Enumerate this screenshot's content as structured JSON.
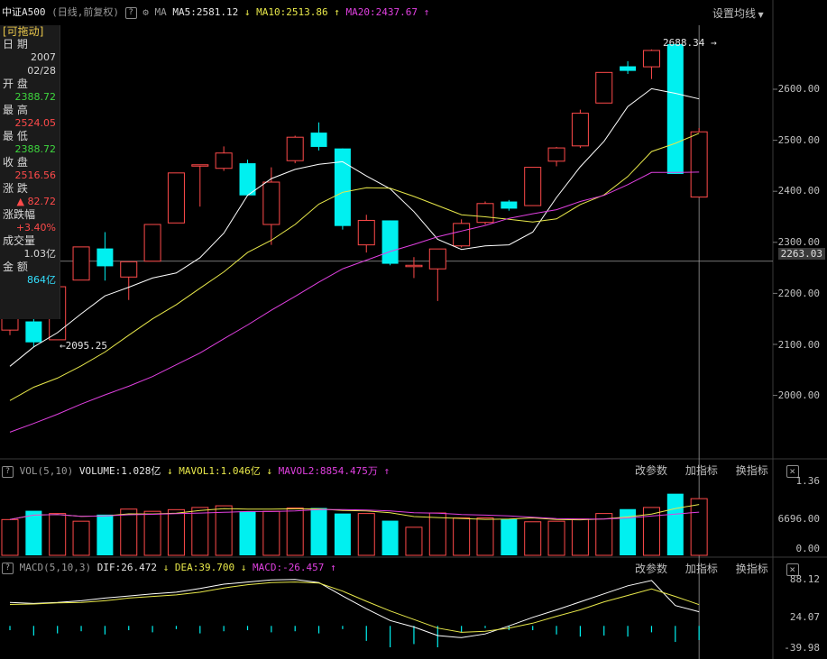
{
  "header": {
    "symbol": "中证A500",
    "period": "(日线,前复权)",
    "help_label": "?",
    "ma_label": "MA",
    "ma5": "MA5:2581.12",
    "ma10": "MA10:2513.86",
    "ma20": "MA20:2437.67",
    "settings_label": "设置均线",
    "arrow_down": "↓",
    "arrow_up": "↑"
  },
  "info": {
    "drag_label": "[可拖动]",
    "date_label": "日  期",
    "date_year": "2007",
    "date_md": "02/28",
    "open_label": "开  盘",
    "open": "2388.72",
    "high_label": "最  高",
    "high": "2524.05",
    "low_label": "最  低",
    "low": "2388.72",
    "close_label": "收  盘",
    "close": "2516.56",
    "change_label": "涨  跌",
    "change": "▲ 82.72",
    "pct_label": "涨跌幅",
    "pct": "+3.40%",
    "volume_label": "成交量",
    "volume": "1.03亿",
    "amount_label": "金  额",
    "amount": "864亿"
  },
  "annotations": {
    "max_label": "2688.34 →",
    "min_label": "←2095.25",
    "cursor_price": "2263.03"
  },
  "price_axis": [
    "2600.00",
    "2500.00",
    "2400.00",
    "2300.00",
    "2200.00",
    "2100.00",
    "2000.00"
  ],
  "volume_panel": {
    "title": "VOL(5,10)",
    "volume": "VOLUME:1.028亿",
    "mavol1": "MAVOL1:1.046亿",
    "mavol2": "MAVOL2:8854.475万",
    "axis": [
      "1.36",
      "6696.00",
      "0.00"
    ]
  },
  "macd_panel": {
    "title": "MACD(5,10,3)",
    "dif": "DIF:26.472",
    "dea": "DEA:39.700",
    "macd": "MACD:-26.457",
    "axis": [
      "88.12",
      "24.07",
      "-39.98"
    ]
  },
  "buttons": {
    "change_params": "改参数",
    "add_indicator": "加指标",
    "switch_indicator": "换指标",
    "close": "×"
  },
  "colors": {
    "up": "#ff4a4a",
    "down": "#00f0f0",
    "ma5": "#ffffff",
    "ma10": "#e8e84a",
    "ma20": "#e040e0"
  },
  "chart_data": {
    "type": "candlestick",
    "price_range": [
      1900,
      2730
    ],
    "candles": [
      {
        "o": 2128,
        "c": 2165,
        "h": 2175,
        "l": 2118
      },
      {
        "o": 2145,
        "c": 2104,
        "h": 2150,
        "l": 2095.25
      },
      {
        "o": 2109,
        "c": 2213,
        "h": 2213,
        "l": 2109
      },
      {
        "o": 2226,
        "c": 2291,
        "h": 2291,
        "l": 2226
      },
      {
        "o": 2288,
        "c": 2253,
        "h": 2320,
        "l": 2225
      },
      {
        "o": 2232,
        "c": 2262,
        "h": 2262,
        "l": 2187
      },
      {
        "o": 2263,
        "c": 2335,
        "h": 2335,
        "l": 2263
      },
      {
        "o": 2338,
        "c": 2436,
        "h": 2436,
        "l": 2338
      },
      {
        "o": 2452,
        "c": 2452,
        "h": 2452,
        "l": 2370
      },
      {
        "o": 2445,
        "c": 2475,
        "h": 2488,
        "l": 2440
      },
      {
        "o": 2455,
        "c": 2392,
        "h": 2462,
        "l": 2392
      },
      {
        "o": 2335,
        "c": 2418,
        "h": 2447,
        "l": 2295
      },
      {
        "o": 2460,
        "c": 2506,
        "h": 2509,
        "l": 2455
      },
      {
        "o": 2515,
        "c": 2487,
        "h": 2535,
        "l": 2480
      },
      {
        "o": 2484,
        "c": 2332,
        "h": 2484,
        "l": 2325
      },
      {
        "o": 2295,
        "c": 2343,
        "h": 2354,
        "l": 2280
      },
      {
        "o": 2343,
        "c": 2258,
        "h": 2343,
        "l": 2255
      },
      {
        "o": 2255,
        "c": 2255,
        "h": 2271,
        "l": 2230
      },
      {
        "o": 2248,
        "c": 2287,
        "h": 2287,
        "l": 2185
      },
      {
        "o": 2293,
        "c": 2337,
        "h": 2345,
        "l": 2290
      },
      {
        "o": 2339,
        "c": 2376,
        "h": 2380,
        "l": 2335
      },
      {
        "o": 2380,
        "c": 2366,
        "h": 2383,
        "l": 2362
      },
      {
        "o": 2372,
        "c": 2447,
        "h": 2447,
        "l": 2372
      },
      {
        "o": 2459,
        "c": 2485,
        "h": 2487,
        "l": 2449
      },
      {
        "o": 2489,
        "c": 2553,
        "h": 2560,
        "l": 2485
      },
      {
        "o": 2573,
        "c": 2633,
        "h": 2633,
        "l": 2573
      },
      {
        "o": 2645,
        "c": 2636,
        "h": 2655,
        "l": 2630
      },
      {
        "o": 2644,
        "c": 2676,
        "h": 2678,
        "l": 2620
      },
      {
        "o": 2688.34,
        "c": 2434,
        "h": 2688.34,
        "l": 2434
      },
      {
        "o": 2388.72,
        "c": 2516.56,
        "h": 2524.05,
        "l": 2388.72
      }
    ],
    "ma5": [
      2057,
      2095,
      2123,
      2160,
      2195,
      2212,
      2230,
      2240,
      2270,
      2318,
      2392,
      2425,
      2443,
      2453,
      2458,
      2430,
      2405,
      2360,
      2306,
      2286,
      2293,
      2295,
      2320,
      2388,
      2448,
      2498,
      2566,
      2601,
      2592,
      2581.12
    ],
    "ma10": [
      1990,
      2016,
      2034,
      2058,
      2085,
      2118,
      2150,
      2178,
      2210,
      2242,
      2280,
      2304,
      2335,
      2375,
      2398,
      2407,
      2406,
      2390,
      2372,
      2354,
      2350,
      2345,
      2340,
      2346,
      2374,
      2393,
      2429,
      2478,
      2494,
      2513.86
    ],
    "ma20": [
      1928,
      1945,
      1963,
      1983,
      2001,
      2018,
      2037,
      2060,
      2083,
      2111,
      2138,
      2167,
      2194,
      2222,
      2248,
      2265,
      2282,
      2296,
      2311,
      2322,
      2333,
      2347,
      2356,
      2364,
      2380,
      2392,
      2413,
      2437,
      2437,
      2437.67
    ],
    "volumes_m": [
      65,
      81,
      76,
      62,
      74,
      84,
      80,
      83,
      87,
      90,
      80,
      80,
      86,
      86,
      76,
      76,
      63,
      51,
      77,
      68,
      68,
      66,
      61,
      62,
      66,
      76,
      84,
      87,
      112,
      103
    ],
    "vol_range": [
      0,
      136
    ],
    "macd_hist": [
      -8,
      -18,
      -14,
      -10,
      -16,
      -8,
      -12,
      -6,
      -14,
      -10,
      -8,
      -12,
      -10,
      -14,
      -6,
      -28,
      -40,
      -34,
      -40,
      -12,
      -4,
      -8,
      -8,
      -16,
      -20,
      -18,
      -20,
      -12,
      -30,
      -26.457
    ],
    "dif": [
      44,
      42,
      44,
      47,
      52,
      56,
      60,
      63,
      70,
      78,
      82,
      86,
      87,
      81,
      56,
      32,
      10,
      -2,
      -18,
      -22,
      -15,
      0,
      16,
      30,
      45,
      60,
      75,
      85,
      38,
      26.472
    ],
    "dea": [
      40,
      41,
      43,
      44,
      47,
      52,
      55,
      58,
      63,
      71,
      77,
      81,
      82,
      80,
      65,
      46,
      28,
      12,
      -4,
      -12,
      -10,
      -4,
      5,
      18,
      30,
      45,
      57,
      69,
      55,
      39.7
    ],
    "macd_range": [
      -39.98,
      88.12
    ]
  }
}
